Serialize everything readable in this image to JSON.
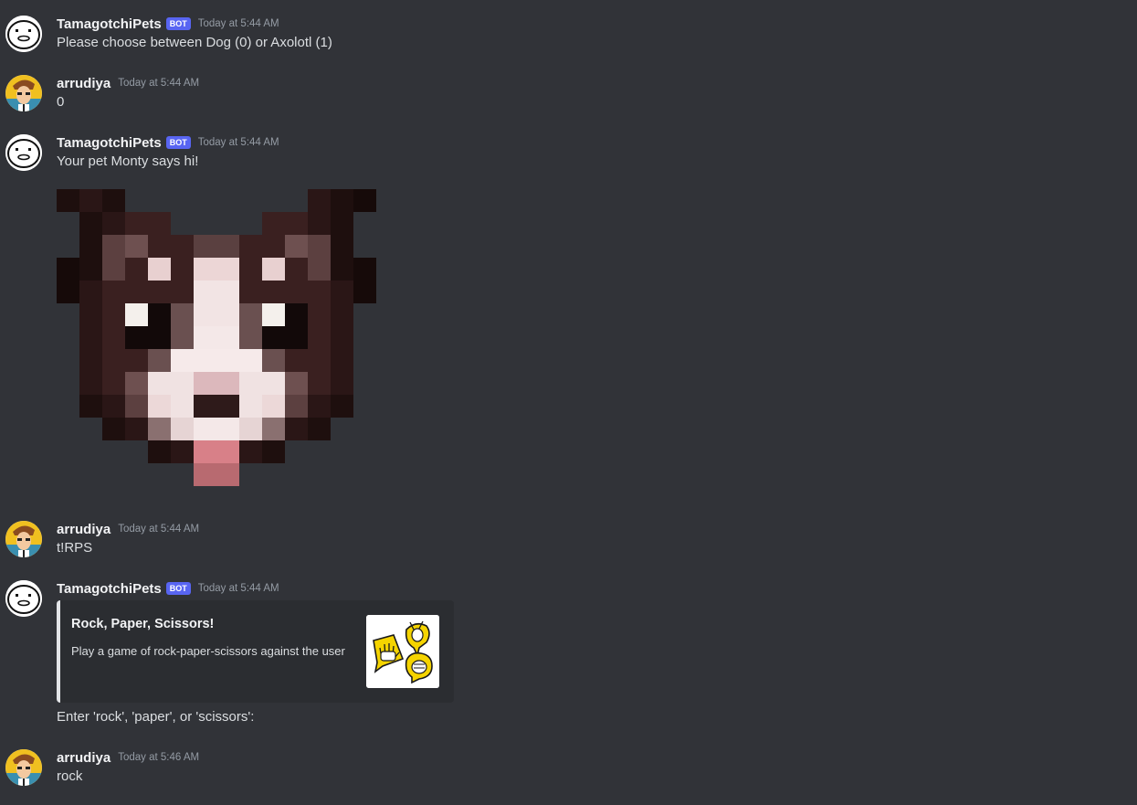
{
  "messages": [
    {
      "username": "TamagotchiPets",
      "bot_tag": "BOT",
      "timestamp": "Today at 5:44 AM",
      "text": "Please choose between Dog (0) or Axolotl (1)"
    },
    {
      "username": "arrudiya",
      "timestamp": "Today at 5:44 AM",
      "text": "0"
    },
    {
      "username": "TamagotchiPets",
      "bot_tag": "BOT",
      "timestamp": "Today at 5:44 AM",
      "text": "Your pet Monty says hi!",
      "image": "pixel-dog-image"
    },
    {
      "username": "arrudiya",
      "timestamp": "Today at 5:44 AM",
      "text": "t!RPS"
    },
    {
      "username": "TamagotchiPets",
      "bot_tag": "BOT",
      "timestamp": "Today at 5:44 AM",
      "embed": {
        "title": "Rock, Paper, Scissors!",
        "description": "Play a game of rock-paper-scissors against the user",
        "thumbnail": "rock-paper-scissors-hands-icon",
        "border_color": "#e3e5e8"
      },
      "text": "Enter 'rock', 'paper', or 'scissors':"
    },
    {
      "username": "arrudiya",
      "timestamp": "Today at 5:46 AM",
      "text": "rock"
    }
  ],
  "colors": {
    "background": "#313338",
    "bot_tag": "#5865f2",
    "embed_background": "#2b2d31",
    "timestamp": "#949ba4"
  }
}
